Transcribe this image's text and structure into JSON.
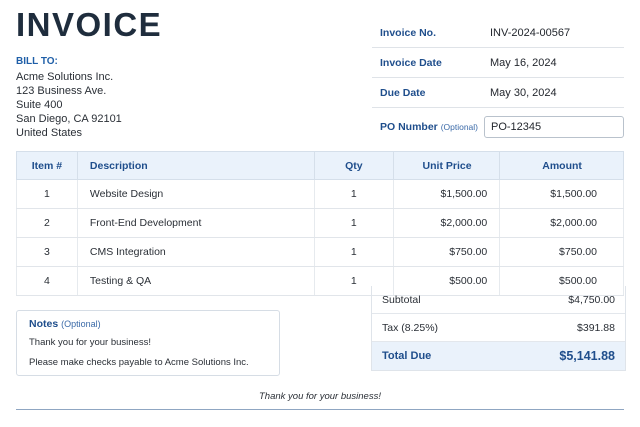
{
  "header": {
    "title": "INVOICE"
  },
  "bill_to": {
    "label": "BILL TO:",
    "lines": [
      "Acme Solutions Inc.",
      "123 Business Ave.",
      "Suite 400",
      "San Diego, CA 92101",
      "United States"
    ]
  },
  "meta": {
    "invoice_no_label": "Invoice No.",
    "invoice_no": "INV-2024-00567",
    "invoice_date_label": "Invoice Date",
    "invoice_date": "May 16, 2024",
    "due_date_label": "Due Date",
    "due_date": "May 30, 2024",
    "po_label": "PO Number",
    "po_optional": "(Optional)",
    "po_value": "PO-12345"
  },
  "table": {
    "headers": [
      "Item #",
      "Description",
      "Qty",
      "Unit Price",
      "Amount"
    ],
    "rows": [
      [
        "1",
        "Website Design",
        "1",
        "$1,500.00",
        "$1,500.00"
      ],
      [
        "2",
        "Front-End Development",
        "1",
        "$2,000.00",
        "$2,000.00"
      ],
      [
        "3",
        "CMS Integration",
        "1",
        "$750.00",
        "$750.00"
      ],
      [
        "4",
        "Testing & QA",
        "1",
        "$500.00",
        "$500.00"
      ]
    ]
  },
  "notes": {
    "title": "Notes",
    "optional": "(Optional)",
    "lines": [
      "Thank you for your business!",
      "Please make checks payable to Acme Solutions Inc."
    ]
  },
  "totals": {
    "subtotal_label": "Subtotal",
    "subtotal": "$4,750.00",
    "tax_label": "Tax (8.25%)",
    "tax": "$391.88",
    "total_label": "Total Due",
    "total": "$5,141.88"
  },
  "footer": {
    "text": "Thank you for your business!"
  },
  "colors": {
    "accent": "#1f4e8c",
    "header_fill": "#eaf2fb",
    "title": "#1f2d3d"
  }
}
